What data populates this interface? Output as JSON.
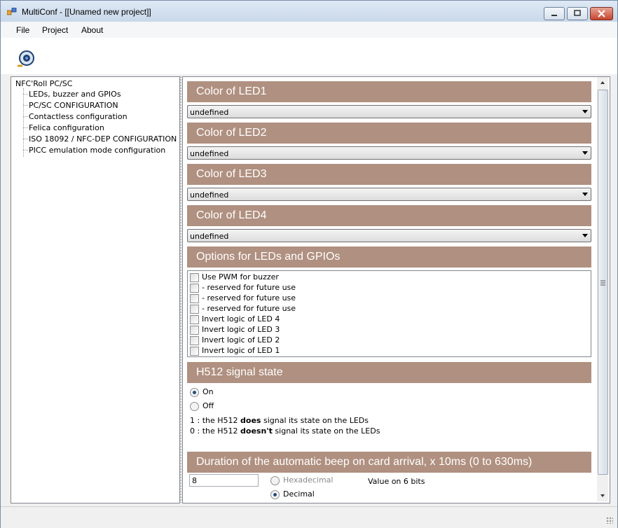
{
  "window": {
    "title": "MultiConf - [[Unamed new project]]"
  },
  "menu": [
    "File",
    "Project",
    "About"
  ],
  "tree": {
    "root": "NFC'Roll PC/SC",
    "children": [
      "LEDs,  buzzer and GPIOs",
      "PC/SC CONFIGURATION",
      "Contactless configuration",
      "Felica configuration",
      "ISO 18092 / NFC-DEP CONFIGURATION",
      "PICC emulation mode configuration"
    ]
  },
  "leds": [
    {
      "header": "Color of LED1",
      "value": "undefined"
    },
    {
      "header": "Color of LED2",
      "value": "undefined"
    },
    {
      "header": "Color of LED3",
      "value": "undefined"
    },
    {
      "header": "Color of LED4",
      "value": "undefined"
    }
  ],
  "options": {
    "header": "Options for LEDs and GPIOs",
    "items": [
      {
        "label": "Use PWM for buzzer",
        "checked": false
      },
      {
        "label": "- reserved for future use",
        "checked": false
      },
      {
        "label": "- reserved for future use",
        "checked": false
      },
      {
        "label": "- reserved for future use",
        "checked": false
      },
      {
        "label": "Invert logic of LED 4",
        "checked": false
      },
      {
        "label": "Invert logic of LED 3",
        "checked": false
      },
      {
        "label": "Invert logic of LED 2",
        "checked": false
      },
      {
        "label": "Invert logic of LED 1",
        "checked": false
      }
    ]
  },
  "h512": {
    "header": "H512 signal state",
    "on_label": "On",
    "off_label": "Off",
    "selected": "On",
    "desc1_prefix": "1 : the H512 ",
    "desc1_bold": "does",
    "desc1_suffix": " signal its state on the LEDs",
    "desc0_prefix": "0 : the H512 ",
    "desc0_bold": "doesn't",
    "desc0_suffix": " signal its state on the LEDs"
  },
  "beep": {
    "header": "Duration  of the automatic beep on card arrival, x 10ms (0 to 630ms)",
    "value": "8",
    "hex_label": "Hexadecimal",
    "dec_label": "Decimal",
    "selected": "Decimal",
    "bits_note": "Value on 6 bits"
  },
  "colors": {
    "section_header": "#b09080"
  }
}
